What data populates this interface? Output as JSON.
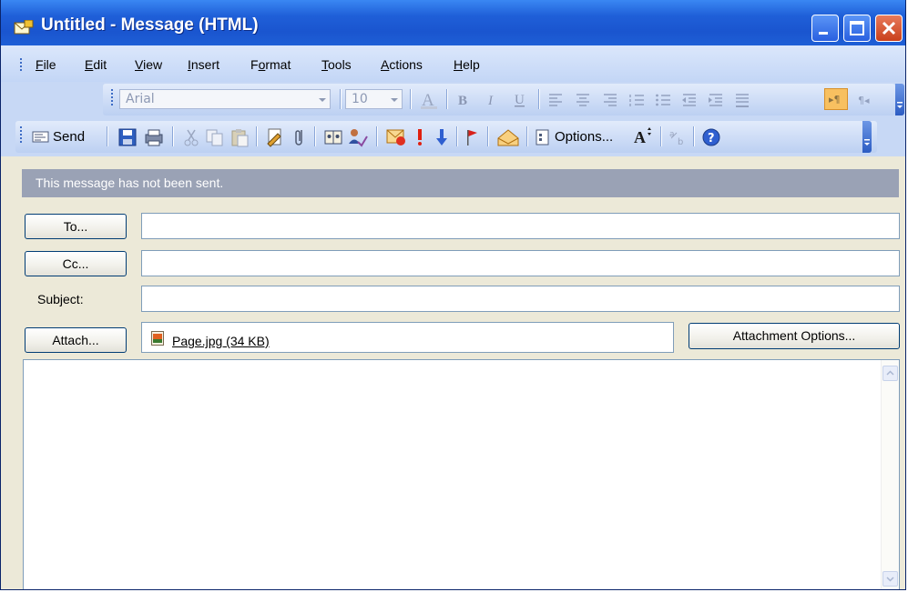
{
  "window": {
    "title": "Untitled - Message (HTML)"
  },
  "menu": [
    "File",
    "Edit",
    "View",
    "Insert",
    "Format",
    "Tools",
    "Actions",
    "Help"
  ],
  "menu_accel": [
    "F",
    "E",
    "V",
    "I",
    "o",
    "T",
    "A",
    "H"
  ],
  "format_toolbar": {
    "font": "Arial",
    "size": "10"
  },
  "standard_toolbar": {
    "send": "Send",
    "options": "Options..."
  },
  "info_bar": "This message has not been sent.",
  "header": {
    "to_button": "To...",
    "cc_button": "Cc...",
    "subject_label": "Subject:",
    "attach_button": "Attach...",
    "attachment": "Page.jpg (34 KB)",
    "attachment_options_button": "Attachment Options...",
    "to_value": "",
    "cc_value": "",
    "subject_value": ""
  },
  "body": {
    "text": ""
  },
  "colors": {
    "title_bar": "#1f5fd8",
    "info_bar": "#9aa2b5"
  }
}
